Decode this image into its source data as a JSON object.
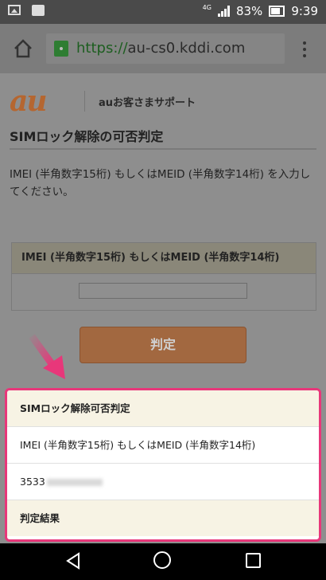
{
  "status_bar": {
    "battery_percent": "83%",
    "time": "9:39",
    "network": "4G"
  },
  "browser": {
    "url_scheme": "https://",
    "url_host": "au-cs0.kddi.com"
  },
  "page": {
    "logo_text": "au",
    "site_name": "auお客さまサポート",
    "heading": "SIMロック解除の可否判定",
    "instruction": "IMEI (半角数字15桁) もしくはMEID (半角数字14桁) を入力してください。",
    "form_header": "IMEI (半角数字15桁) もしくはMEID (半角数字14桁)",
    "imei_value": "",
    "judge_button": "判定"
  },
  "result_panel": {
    "title": "SIMロック解除可否判定",
    "field_label": "IMEI (半角数字15桁) もしくはMEID (半角数字14桁)",
    "imei_visible_prefix": "3533",
    "result_label": "判定結果"
  },
  "colors": {
    "highlight_border": "#e8377a",
    "au_orange": "#eb7a35",
    "https_green": "#1d5e20"
  }
}
